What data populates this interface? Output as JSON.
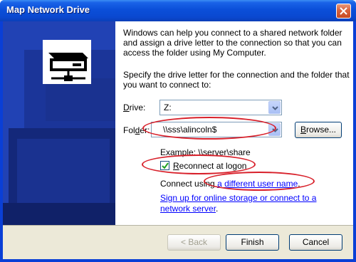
{
  "window": {
    "title": "Map Network Drive"
  },
  "intro": {
    "text": "Windows can help you connect to a shared network folder and assign a drive letter to the connection so that you can access the folder using My Computer."
  },
  "instruction": {
    "text": "Specify the drive letter for the connection and the folder that you want to connect to:"
  },
  "drive": {
    "label_prefix": "",
    "label_underlined": "D",
    "label_rest": "rive:",
    "value": "Z:"
  },
  "folder": {
    "label_prefix": "Fol",
    "label_underlined": "d",
    "label_rest": "er:",
    "value": "\\\\sss\\alincoln$",
    "browse_prefix": "",
    "browse_underlined": "B",
    "browse_rest": "rowse..."
  },
  "example": {
    "text": "Example: \\\\server\\share"
  },
  "reconnect": {
    "checked": true,
    "label_prefix": "",
    "label_underlined": "R",
    "label_rest": "econnect at logon"
  },
  "connect_using": {
    "prefix": "Connect using ",
    "link": "a different user name",
    "suffix": "."
  },
  "signup": {
    "line1": "Sign up for online storage or connect to a",
    "line2": "network server"
  },
  "signup_suffix": ".",
  "buttons": {
    "back": "< Back",
    "finish": "Finish",
    "cancel": "Cancel"
  },
  "colors": {
    "titlebar": "#0a48d0",
    "left_panel": "#1f3fb0",
    "annotation": "#d8202a",
    "link": "#0000ff"
  },
  "icons": {
    "left_panel_art": "network-drive-illustration",
    "close": "close-icon",
    "dropdown": "chevron-down-icon",
    "check": "check-icon"
  }
}
